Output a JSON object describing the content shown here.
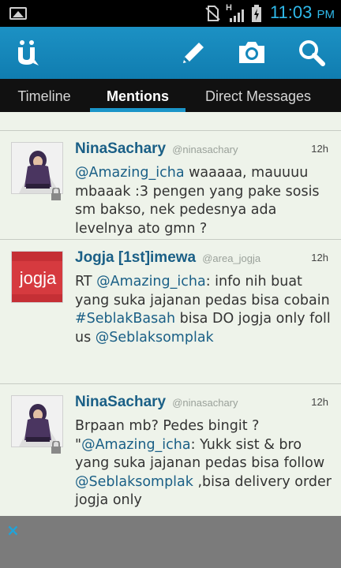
{
  "status_bar": {
    "time": "11:03",
    "ampm": "PM",
    "network_type": "H"
  },
  "action_bar": {
    "logo_icon": "ubersocial-logo-icon",
    "compose_icon": "pencil-icon",
    "camera_icon": "camera-icon",
    "search_icon": "search-icon"
  },
  "tabs": [
    {
      "label": "Timeline",
      "active": false
    },
    {
      "label": "Mentions",
      "active": true
    },
    {
      "label": "Direct Messages",
      "active": false
    }
  ],
  "tweets": [
    {
      "name": "NinaSachary",
      "handle": "@ninasachary",
      "time": "12h",
      "protected": true,
      "mention": "@Amazing_icha",
      "text": " waaaaa, mauuuu mbaaak :3 pengen yang pake sosis sm bakso, nek pedesnya ada levelnya ato gmn ?"
    },
    {
      "name": "Jogja [1st]imewa",
      "handle": "@area_jogja",
      "time": "12h",
      "protected": false,
      "avatar_text": "jogja",
      "text_rt": "RT ",
      "mention": "@Amazing_icha",
      "text_1": ": info nih buat yang suka jajanan pedas bisa cobain ",
      "hashtag": "#SeblakBasah",
      "text_2": " bisa DO jogja only foll us ",
      "mention_2": "@Seblaksomplak"
    },
    {
      "name": "NinaSachary",
      "handle": "@ninasachary",
      "time": "12h",
      "protected": true,
      "text_1": "Brpaan mb? Pedes bingit ? \"",
      "mention": "@Amazing_icha",
      "text_2": ": Yukk sist & bro yang suka jajanan pedas bisa follow ",
      "mention_2": "@Seblaksomplak",
      "text_3": " ,bisa delivery order jogja only"
    }
  ],
  "bottom_bar": {
    "close_label": "×"
  }
}
